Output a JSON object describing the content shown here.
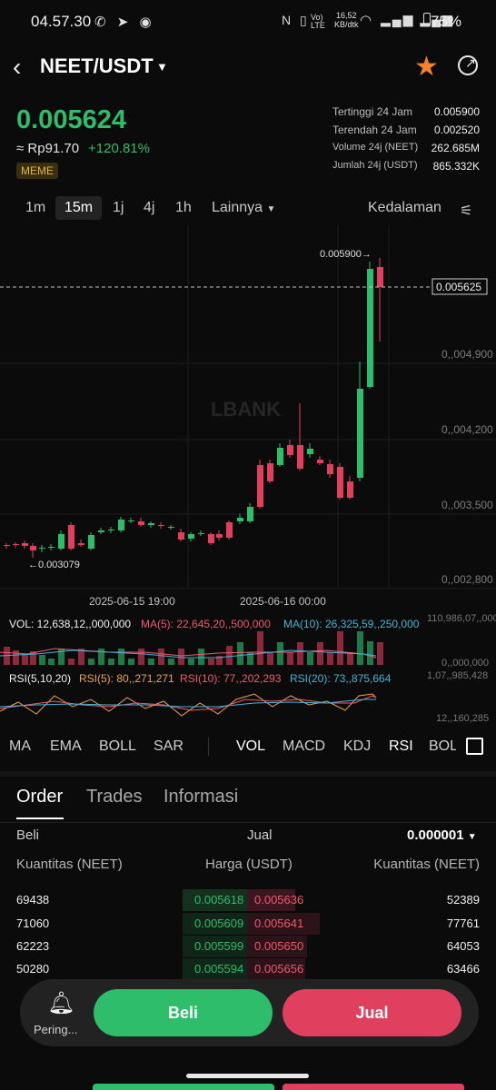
{
  "status": {
    "time": "04.57.30",
    "network_top": "16,52",
    "network_bottom": "KB/dtk",
    "battery": "75%",
    "vol_label": "Vo) LTE2"
  },
  "header": {
    "pair": "NEET/USDT"
  },
  "ticker": {
    "last": "0.005624",
    "rp": "≈ Rp91.70",
    "change": "+120.81%",
    "tag": "MEME"
  },
  "stats": [
    {
      "label": "Tertinggi 24 Jam",
      "value": "0.005900"
    },
    {
      "label": "Terendah 24 Jam",
      "value": "0.002520"
    },
    {
      "label": "Volume 24j (NEET)",
      "value": "262.685M"
    },
    {
      "label": "Jumlah 24j (USDT)",
      "value": "865.332K"
    }
  ],
  "timeframes": [
    "1m",
    "15m",
    "1j",
    "4j",
    "1h"
  ],
  "timeframe_active": "15m",
  "more_label": "Lainnya",
  "depth_label": "Kedalaman",
  "chart": {
    "watermark": "LBANK",
    "high_marker": "0.005900",
    "low_marker": "0.003079",
    "current_price_tag": "0.005625",
    "price_axis": [
      "0,,004,900",
      "0,,004,200",
      "0,,003,500",
      "0,,002,800"
    ],
    "time_labels": [
      "2025-06-15 19:00",
      "2025-06-16 00:00"
    ],
    "vol_line": {
      "vol": "VOL: 12,638,12,,000,000",
      "ma5": "MA(5): 22,645,20,,500,000",
      "ma10": "MA(10): 26,325,59,,250,000",
      "axis_top": "110,986,07,,000,000",
      "axis_bottom": "0,,000,000"
    },
    "rsi_line": {
      "name": "RSI(5,10,20)",
      "rsi5": "RSI(5): 80,,271,271",
      "rsi10": "RSI(10): 77,,202,293",
      "rsi20": "RSI(20): 73,,875,664",
      "axis_top": "1,07,,985,428",
      "axis_bottom": "12,,160,285"
    }
  },
  "indicator_tabs_left": [
    "MA",
    "EMA",
    "BOLL",
    "SAR"
  ],
  "indicator_tabs_right": [
    "VOL",
    "MACD",
    "KDJ",
    "RSI",
    "BOLL"
  ],
  "order_tabs": [
    "Order",
    "Trades",
    "Informasi"
  ],
  "orderbook": {
    "buy_label": "Beli",
    "sell_label": "Jual",
    "precision": "0.000001",
    "col_qty_left": "Kuantitas (NEET)",
    "col_price": "Harga (USDT)",
    "col_qty_right": "Kuantitas (NEET)",
    "rows": [
      {
        "bid_qty": "69438",
        "bid": "0.005618",
        "ask": "0.005636",
        "ask_qty": "52389"
      },
      {
        "bid_qty": "71060",
        "bid": "0.005609",
        "ask": "0.005641",
        "ask_qty": "77761"
      },
      {
        "bid_qty": "62223",
        "bid": "0.005599",
        "ask": "0.005650",
        "ask_qty": "64053"
      },
      {
        "bid_qty": "50280",
        "bid": "0.005594",
        "ask": "0.005656",
        "ask_qty": "63466"
      }
    ]
  },
  "actions": {
    "alert": "Pering...",
    "buy": "Beli",
    "sell": "Jual"
  },
  "colors": {
    "up": "#2ebd6b",
    "down": "#e0405e",
    "accent": "#f3822a"
  }
}
